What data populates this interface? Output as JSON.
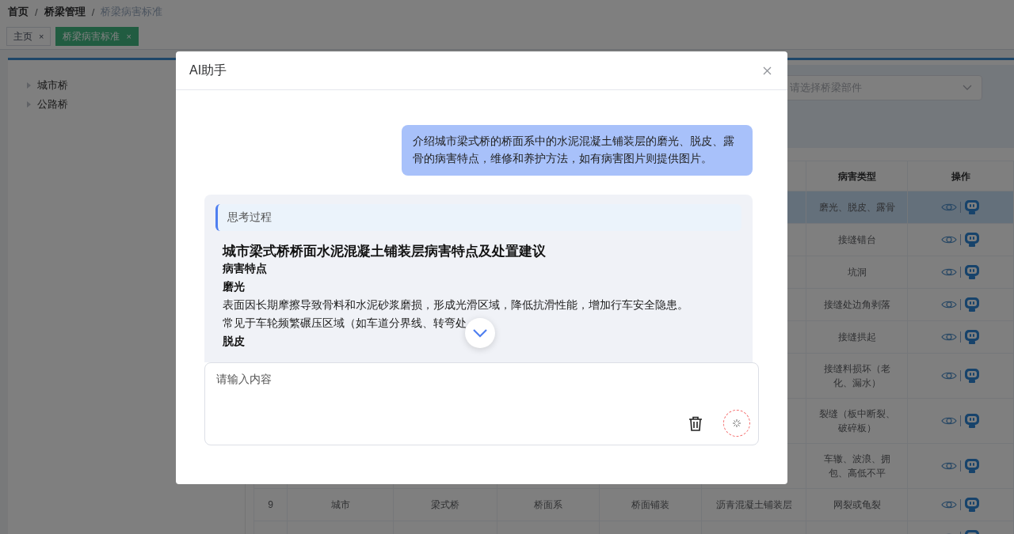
{
  "breadcrumb": {
    "separator": "/",
    "items": [
      "首页",
      "桥梁管理",
      "桥梁病害标准"
    ]
  },
  "tabs": [
    {
      "label": "主页",
      "selected": false,
      "close": "×"
    },
    {
      "label": "桥梁病害标准",
      "selected": true,
      "close": "×"
    }
  ],
  "tree": [
    {
      "label": "城市桥",
      "expanded": false
    },
    {
      "label": "公路桥",
      "expanded": false
    }
  ],
  "filter": {
    "placeholder": "请选择桥梁部件"
  },
  "table": {
    "header": {
      "column_7": "病害类型",
      "column_8": "操作"
    },
    "rows": [
      {
        "highlighted": true,
        "column_7": "磨光、脱皮、露骨"
      },
      {
        "highlighted": false,
        "column_7": "接缝错台"
      },
      {
        "highlighted": false,
        "column_7": "坑洞"
      },
      {
        "highlighted": false,
        "column_7": "接缝处边角剥落"
      },
      {
        "highlighted": false,
        "column_7": "接缝拱起"
      },
      {
        "highlighted": false,
        "column_7": "接缝料损坏（老化、漏水）"
      },
      {
        "highlighted": false,
        "column_7": "裂缝（板中断裂、破碎板）"
      },
      {
        "highlighted": false,
        "column_7": "车辙、波浪、拥包、高低不平"
      },
      {
        "highlighted": false,
        "column_1": "9",
        "column_2": "城市",
        "column_3": "梁式桥",
        "column_4": "桥面系",
        "column_5": "桥面铺装",
        "column_6": "沥青混凝土铺装层",
        "column_7": "网裂或龟裂"
      },
      {
        "highlighted": false
      }
    ]
  },
  "dialog": {
    "title": "AI助手",
    "messages": [
      {
        "kind": "user",
        "text": "介绍城市梁式桥的桥面系中的水泥混凝土铺装层的磨光、脱皮、露骨的病害特点，维修和养护方法，如有病害图片则提供图片。"
      },
      {
        "kind": "assistant",
        "thinking_label": "思考过程",
        "blocks": [
          {
            "kind": "title",
            "text": "城市梁式桥桥面水泥混凝土铺装层病害特点及处置建议"
          },
          {
            "kind": "heading",
            "text": "病害特点"
          },
          {
            "kind": "heading",
            "text": "磨光"
          },
          {
            "kind": "paragraph",
            "text": "表面因长期摩擦导致骨料和水泥砂浆磨损，形成光滑区域，降低抗滑性能，增加行车安全隐患。"
          },
          {
            "kind": "paragraph",
            "text": "常见于车轮频繁碾压区域（如车道分界线、转弯处"
          },
          {
            "kind": "heading",
            "text": "脱皮"
          }
        ]
      }
    ],
    "input": {
      "placeholder": "请输入内容"
    }
  }
}
